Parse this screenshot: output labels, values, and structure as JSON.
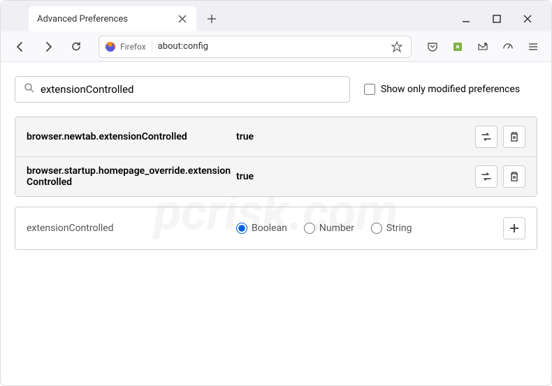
{
  "window": {
    "tab_title": "Advanced Preferences"
  },
  "urlbar": {
    "identity": "Firefox",
    "url": "about:config"
  },
  "search": {
    "value": "extensionControlled",
    "show_only_label": "Show only modified preferences"
  },
  "prefs": [
    {
      "name": "browser.newtab.extensionControlled",
      "value": "true"
    },
    {
      "name": "browser.startup.homepage_override.extensionControlled",
      "value": "true"
    }
  ],
  "new_pref": {
    "name": "extensionControlled",
    "types": [
      "Boolean",
      "Number",
      "String"
    ],
    "selected": "Boolean"
  },
  "watermark": "pcrisk.com"
}
